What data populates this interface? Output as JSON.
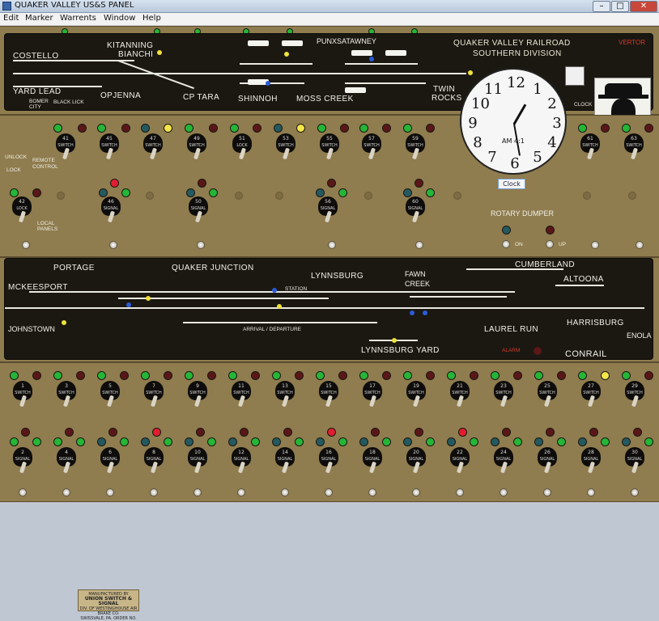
{
  "window": {
    "title": "QUAKER VALLEY US&S PANEL",
    "min": "–",
    "max": "□",
    "close": "✕"
  },
  "menu": [
    "Edit",
    "Marker",
    "Warrents",
    "Window",
    "Help"
  ],
  "top_board": {
    "title1": "QUAKER VALLEY RAILROAD",
    "title2": "SOUTHERN DIVISION",
    "vertor": "VERTOR",
    "places": [
      "COSTELLO",
      "KITANNING",
      "BIANCHI",
      "PUNXSATAWNEY",
      "YARD LEAD",
      "OPJENNA",
      "CP TARA",
      "SHINNOH",
      "MOSS CREEK",
      "TWIN",
      "ROCKS",
      "BOMER",
      "CITY",
      "BLACK LICK"
    ],
    "clock_button": "CLOCK"
  },
  "clock": {
    "label": "Clock",
    "am": "AM 4:1",
    "numerals": [
      "12",
      "1",
      "2",
      "3",
      "4",
      "5",
      "6",
      "7",
      "8",
      "9",
      "10",
      "11"
    ]
  },
  "mid_panel": {
    "unlock": "UNLOCK",
    "lock": "LOCK",
    "remote": "REMOTE",
    "control": "CONTROL",
    "local": "LOCAL",
    "panels": "PANELS",
    "rotary": "ROTARY DUMPER",
    "on": "ON",
    "up": "UP"
  },
  "mid_levers_top": [
    {
      "num": "41",
      "label": "SWITCH"
    },
    {
      "num": "45",
      "label": "SWITCH"
    },
    {
      "num": "47",
      "label": "SWITCH"
    },
    {
      "num": "49",
      "label": "SWITCH"
    },
    {
      "num": "51",
      "label": "LOCK"
    },
    {
      "num": "53",
      "label": "SWITCH"
    },
    {
      "num": "55",
      "label": "SWITCH"
    },
    {
      "num": "57",
      "label": "SWITCH"
    },
    {
      "num": "59",
      "label": "SWITCH"
    },
    {
      "num": "61",
      "label": "SWITCH"
    },
    {
      "num": "63",
      "label": "SWITCH"
    }
  ],
  "mid_levers_bottom": [
    {
      "num": "42",
      "label": "LOCK"
    },
    {
      "num": "46",
      "label": "SIGNAL"
    },
    {
      "num": "50",
      "label": "SIGNAL"
    },
    {
      "num": "56",
      "label": "SIGNAL"
    },
    {
      "num": "60",
      "label": "SIGNAL"
    }
  ],
  "bottom_board": {
    "places": [
      "PORTAGE",
      "QUAKER JUNCTION",
      "LYNNSBURG",
      "FAWN",
      "CREEK",
      "CUMBERLAND",
      "ALTOONA",
      "MCKEESPORT",
      "JOHNSTOWN",
      "LAUREL RUN",
      "HARRISBURG",
      "ENOLA",
      "LYNNSBURG YARD",
      "CONRAIL",
      "ALARM",
      "STATION",
      "ARRIVAL / DEPARTURE"
    ],
    "plate": [
      "MANUFACTURED BY",
      "UNION SWITCH & SIGNAL",
      "DIV. OF WESTINGHOUSE AIR BRAKE CO.",
      "SWISSVALE, PA.   ORDER NO."
    ]
  },
  "bottom_switch_row": [
    "1",
    "3",
    "5",
    "7",
    "9",
    "11",
    "13",
    "15",
    "17",
    "19",
    "21",
    "23",
    "25",
    "27",
    "29"
  ],
  "bottom_signal_row": [
    "2",
    "4",
    "6",
    "8",
    "10",
    "12",
    "14",
    "16",
    "18",
    "20",
    "22",
    "24",
    "26",
    "28",
    "30"
  ],
  "colors": {
    "panel": "#8f7c4f",
    "board": "#1b1812",
    "lamp_green": "#25b637",
    "lamp_red": "#e11d30",
    "lamp_yellow": "#f3e64a",
    "lamp_blue": "#2a5bd8"
  }
}
